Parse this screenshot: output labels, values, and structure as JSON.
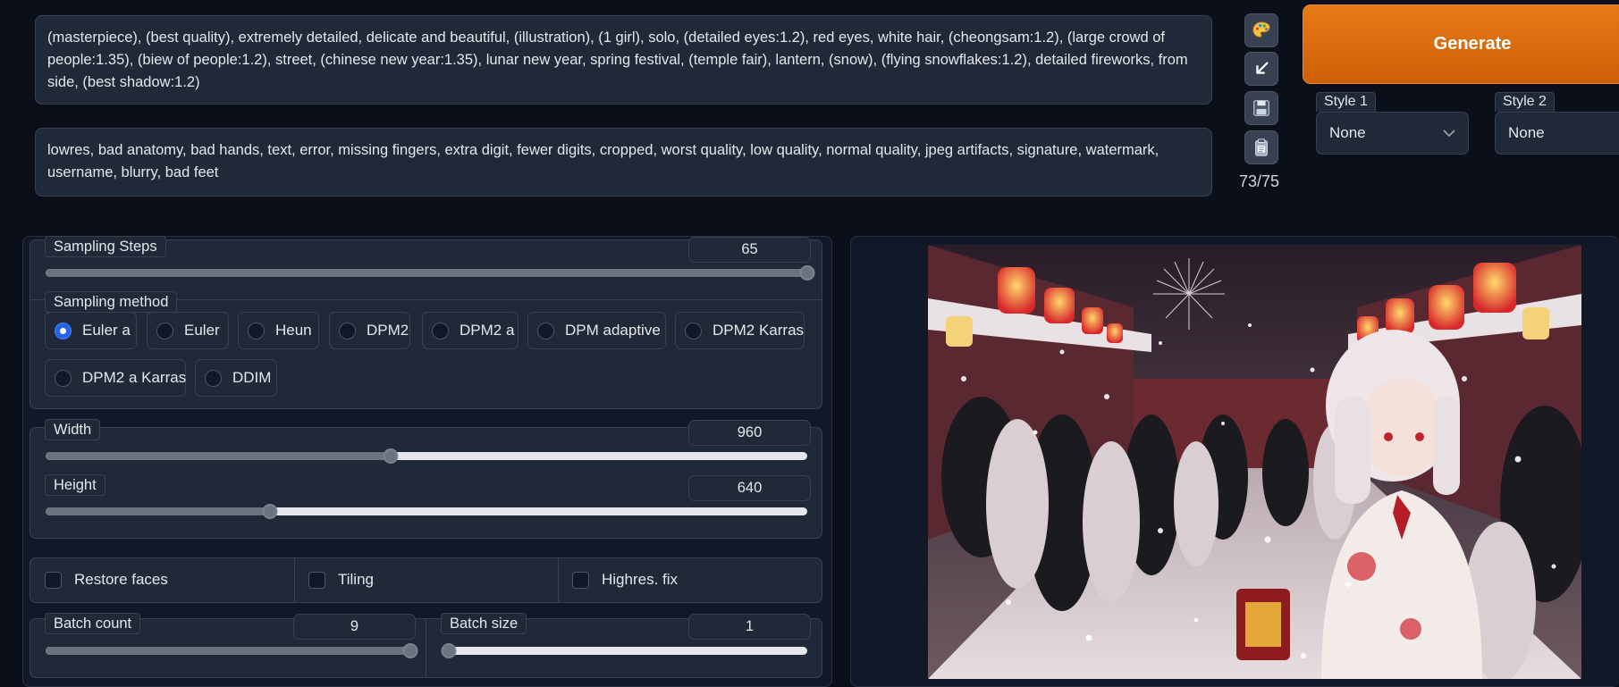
{
  "prompt": {
    "positive": "(masterpiece), (best quality), extremely detailed, delicate and beautiful, (illustration), (1 girl), solo, (detailed eyes:1.2), red eyes, white hair, (cheongsam:1.2), (large crowd of people:1.35), (biew of people:1.2), street, (chinese new year:1.35), lunar new year, spring festival, (temple fair), lantern, (snow), (flying snowflakes:1.2), detailed fireworks, from side, (best shadow:1.2)",
    "negative": "lowres, bad anatomy, bad hands, text, error, missing fingers, extra digit, fewer digits, cropped, worst quality, low quality, normal quality, jpeg artifacts, signature, watermark, username, blurry, bad feet"
  },
  "tools": {
    "icons": [
      "palette-icon",
      "arrow-down-left-icon",
      "save-icon",
      "clipboard-icon"
    ],
    "token_count": "73/75"
  },
  "generate_label": "Generate",
  "styles": [
    {
      "label": "Style 1",
      "value": "None"
    },
    {
      "label": "Style 2",
      "value": "None"
    }
  ],
  "sampling_steps": {
    "label": "Sampling Steps",
    "value": "65",
    "min": 1,
    "max": 150
  },
  "sampling_method": {
    "label": "Sampling method",
    "selected": "Euler a",
    "options": [
      "Euler a",
      "Euler",
      "Heun",
      "DPM2",
      "DPM2 a",
      "DPM adaptive",
      "DPM2 Karras",
      "DPM2 a Karras",
      "DDIM"
    ]
  },
  "width": {
    "label": "Width",
    "value": "960",
    "min": 64,
    "max": 2048
  },
  "height": {
    "label": "Height",
    "value": "640",
    "min": 64,
    "max": 2048
  },
  "checkboxes": [
    {
      "label": "Restore faces",
      "checked": false
    },
    {
      "label": "Tiling",
      "checked": false
    },
    {
      "label": "Highres. fix",
      "checked": false
    }
  ],
  "batch_count": {
    "label": "Batch count",
    "value": "9",
    "min": 1,
    "max": 9
  },
  "batch_size": {
    "label": "Batch size",
    "value": "1",
    "min": 1,
    "max": 8
  },
  "colors": {
    "background": "#0b0f19",
    "panel": "#1f2937",
    "accent": "#e67a17",
    "radio_selected": "#2563eb"
  },
  "output_image": {
    "description_icon": "generated-image"
  }
}
